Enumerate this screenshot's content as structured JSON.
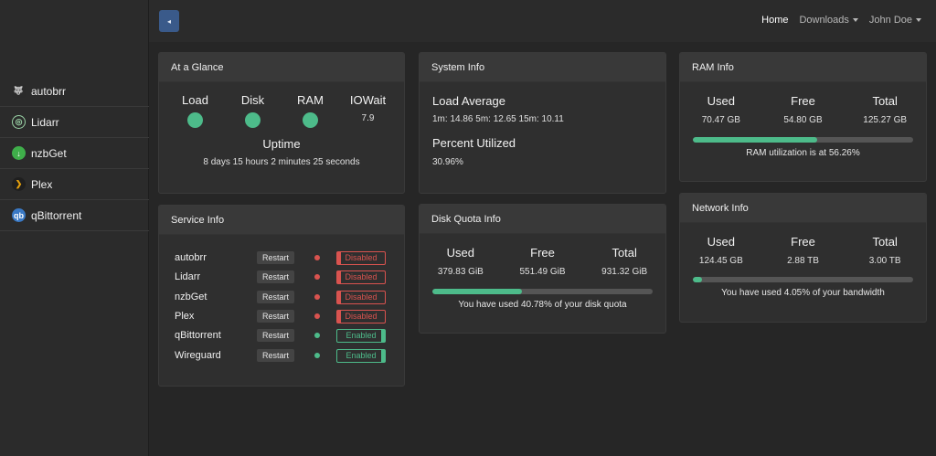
{
  "colors": {
    "accent_green": "#4dbb8a",
    "danger_red": "#d9534f",
    "toggle_blue": "#3a5a8a"
  },
  "sidebar": {
    "items": [
      {
        "label": "autobrr",
        "icon": "autobrr-icon"
      },
      {
        "label": "Lidarr",
        "icon": "lidarr-icon"
      },
      {
        "label": "nzbGet",
        "icon": "nzbget-icon"
      },
      {
        "label": "Plex",
        "icon": "plex-icon"
      },
      {
        "label": "qBittorrent",
        "icon": "qbittorrent-icon"
      }
    ]
  },
  "topbar": {
    "toggle_icon": "◂",
    "nav": {
      "home": "Home",
      "downloads": "Downloads",
      "user": "John Doe"
    }
  },
  "glance": {
    "title": "At a Glance",
    "load_label": "Load",
    "disk_label": "Disk",
    "ram_label": "RAM",
    "iowait_label": "IOWait",
    "iowait_value": "7.9",
    "uptime_label": "Uptime",
    "uptime_value": "8 days 15 hours 2 minutes 25 seconds"
  },
  "system": {
    "title": "System Info",
    "load_label": "Load Average",
    "load_value": "1m: 14.86 5m: 12.65 15m: 10.11",
    "percent_label": "Percent Utilized",
    "percent_value": "30.96%"
  },
  "ram": {
    "title": "RAM Info",
    "used_label": "Used",
    "used_value": "70.47 GB",
    "free_label": "Free",
    "free_value": "54.80 GB",
    "total_label": "Total",
    "total_value": "125.27 GB",
    "percent": 56.26,
    "caption": "RAM utilization is at 56.26%"
  },
  "services": {
    "title": "Service Info",
    "restart_label": "Restart",
    "rows": [
      {
        "name": "autobrr",
        "status": "Disabled"
      },
      {
        "name": "Lidarr",
        "status": "Disabled"
      },
      {
        "name": "nzbGet",
        "status": "Disabled"
      },
      {
        "name": "Plex",
        "status": "Disabled"
      },
      {
        "name": "qBittorrent",
        "status": "Enabled"
      },
      {
        "name": "Wireguard",
        "status": "Enabled"
      }
    ]
  },
  "disk": {
    "title": "Disk Quota Info",
    "used_label": "Used",
    "used_value": "379.83 GiB",
    "free_label": "Free",
    "free_value": "551.49 GiB",
    "total_label": "Total",
    "total_value": "931.32 GiB",
    "percent": 40.78,
    "caption": "You have used 40.78% of your disk quota"
  },
  "network": {
    "title": "Network Info",
    "used_label": "Used",
    "used_value": "124.45 GB",
    "free_label": "Free",
    "free_value": "2.88 TB",
    "total_label": "Total",
    "total_value": "3.00 TB",
    "percent": 4.05,
    "caption": "You have used 4.05% of your bandwidth"
  }
}
